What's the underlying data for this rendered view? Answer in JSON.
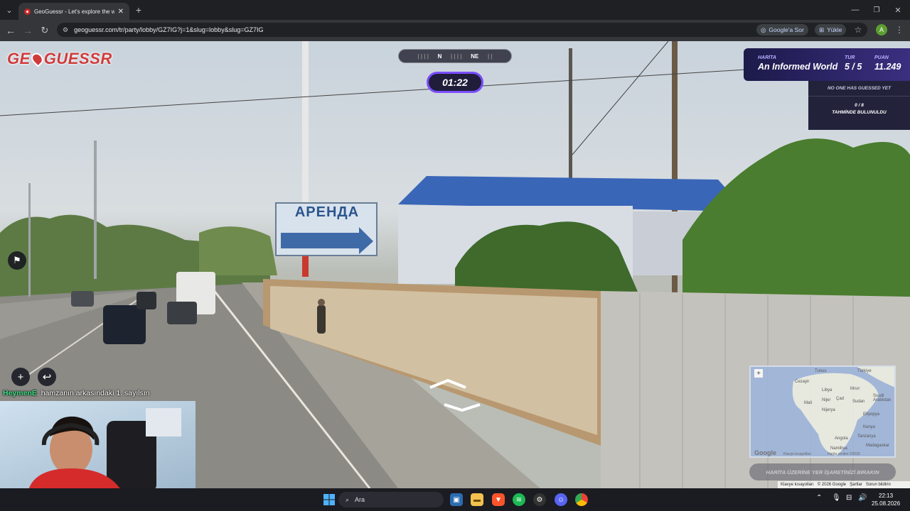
{
  "browser": {
    "tab_title": "GeoGuessr - Let's explore the w",
    "new_tab": "+",
    "url": "geoguessr.com/tr/party/lobby/GZ7IG?j=1&slug=lobby&slug=GZ7IG",
    "google_ask": "Google'a Sor",
    "install": "Yükle",
    "profile": "A"
  },
  "game": {
    "logo_left": "GE",
    "logo_right": "GUESSR",
    "compass": {
      "n": "N",
      "ne": "NE"
    },
    "timer": "01:22",
    "map_label": "HARİTA",
    "map_name": "An Informed World",
    "round_label": "TUR",
    "round_value": "5 / 5",
    "score_label": "PUAN",
    "score_value": "11.249",
    "no_guess": "NO ONE HAS GUESSED YET",
    "guess_count": "0 / 8",
    "guess_count_label": "TAHMİNDE BULUNULDU",
    "sign_text": "АРЕНДА",
    "guess_button": "HARİTA ÜZERİNE YER İŞARETİNİZİ BIRAKIN",
    "map_countries": [
      "Türkiye",
      "Tunus",
      "Cezayir",
      "Libya",
      "Mısır",
      "Suudi Arabistan",
      "Mali",
      "Nijer",
      "Çad",
      "Sudan",
      "Nijerya",
      "Etiyopya",
      "Kenya",
      "Tanzanya",
      "Angola",
      "Namibya",
      "Madagaskar"
    ],
    "map_keyboard": "Klavye kısayolları",
    "map_data": "Harita verileri ©2026",
    "footer": [
      "Klavye kısayolları",
      "© 2026 Google",
      "Şartlar",
      "Sorun bildirin"
    ],
    "google_logo": "Google"
  },
  "chat": {
    "user": "HeymenE",
    "message": ": hamzanın arkasındaki 1. sayılsın"
  },
  "taskbar": {
    "search": "Ara",
    "time": "22:13",
    "date": "25.08.2026"
  }
}
